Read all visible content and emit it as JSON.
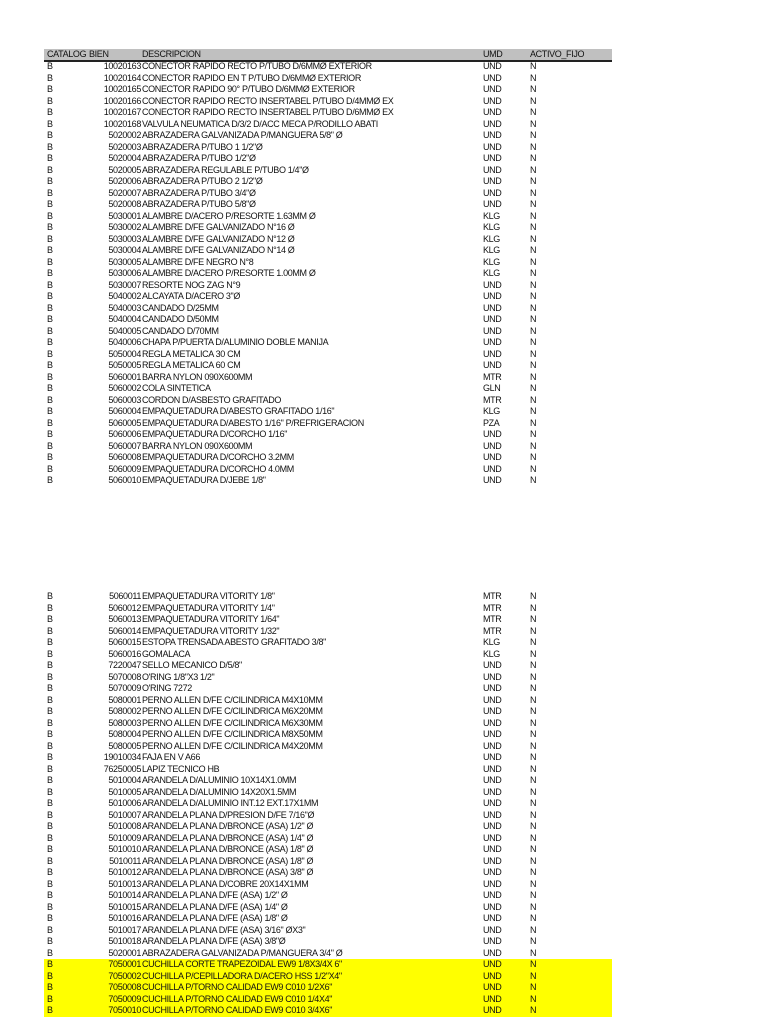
{
  "header": {
    "catalogo": "CATALOG",
    "bien": "BIEN",
    "descripcion": "DESCRIPCION",
    "umd": "UMD",
    "activo_fijo": "ACTIVO_FIJO"
  },
  "colors": {
    "header_bg": "#c0c0c0",
    "highlight": "#ffff00"
  },
  "blocks": [
    [
      [
        "B",
        "10020163",
        "CONECTOR RAPIDO RECTO P/TUBO D/6MMØ EXTERIOR",
        "UND",
        "N"
      ],
      [
        "B",
        "10020164",
        "CONECTOR RAPIDO EN T P/TUBO D/6MMØ EXTERIOR",
        "UND",
        "N"
      ],
      [
        "B",
        "10020165",
        "CONECTOR RAPIDO 90° P/TUBO D/6MMØ EXTERIOR",
        "UND",
        "N"
      ],
      [
        "B",
        "10020166",
        "CONECTOR RAPIDO RECTO INSERTABEL P/TUBO D/4MMØ EX",
        "UND",
        "N"
      ],
      [
        "B",
        "10020167",
        "CONECTOR RAPIDO RECTO INSERTABEL P/TUBO D/6MMØ EX",
        "UND",
        "N"
      ],
      [
        "B",
        "10020168",
        "VALVULA NEUMATICA D/3/2 D/ACC MECA P/RODILLO ABATI",
        "UND",
        "N"
      ],
      [
        "B",
        "5020002",
        "ABRAZADERA GALVANIZADA P/MANGUERA 5/8\" Ø",
        "UND",
        "N"
      ],
      [
        "B",
        "5020003",
        "ABRAZADERA P/TUBO 1 1/2\"Ø",
        "UND",
        "N"
      ],
      [
        "B",
        "5020004",
        "ABRAZADERA P/TUBO 1/2\"Ø",
        "UND",
        "N"
      ],
      [
        "B",
        "5020005",
        "ABRAZADERA REGULABLE P/TUBO 1/4\"Ø",
        "UND",
        "N"
      ],
      [
        "B",
        "5020006",
        "ABRAZADERA P/TUBO 2 1/2\"Ø",
        "UND",
        "N"
      ],
      [
        "B",
        "5020007",
        "ABRAZADERA P/TUBO 3/4\"Ø",
        "UND",
        "N"
      ],
      [
        "B",
        "5020008",
        "ABRAZADERA P/TUBO 5/8\"Ø",
        "UND",
        "N"
      ],
      [
        "B",
        "5030001",
        "ALAMBRE D/ACERO P/RESORTE 1.63MM Ø",
        "KLG",
        "N"
      ],
      [
        "B",
        "5030002",
        "ALAMBRE D/FE GALVANIZADO N°16 Ø",
        "KLG",
        "N"
      ],
      [
        "B",
        "5030003",
        "ALAMBRE D/FE GALVANIZADO N°12 Ø",
        "KLG",
        "N"
      ],
      [
        "B",
        "5030004",
        "ALAMBRE D/FE GALVANIZADO N°14 Ø",
        "KLG",
        "N"
      ],
      [
        "B",
        "5030005",
        "ALAMBRE D/FE NEGRO N°8",
        "KLG",
        "N"
      ],
      [
        "B",
        "5030006",
        "ALAMBRE D/ACERO P/RESORTE 1.00MM Ø",
        "KLG",
        "N"
      ],
      [
        "B",
        "5030007",
        "RESORTE NOG ZAG N°9",
        "UND",
        "N"
      ],
      [
        "B",
        "5040002",
        "ALCAYATA D/ACERO 3\"Ø",
        "UND",
        "N"
      ],
      [
        "B",
        "5040003",
        "CANDADO D/25MM",
        "UND",
        "N"
      ],
      [
        "B",
        "5040004",
        "CANDADO D/50MM",
        "UND",
        "N"
      ],
      [
        "B",
        "5040005",
        "CANDADO D/70MM",
        "UND",
        "N"
      ],
      [
        "B",
        "5040006",
        "CHAPA P/PUERTA D/ALUMINIO DOBLE MANIJA",
        "UND",
        "N"
      ],
      [
        "B",
        "5050004",
        "REGLA METALICA 30 CM",
        "UND",
        "N"
      ],
      [
        "B",
        "5050005",
        "REGLA METALICA 60 CM",
        "UND",
        "N"
      ],
      [
        "B",
        "5060001",
        "BARRA NYLON 090X600MM",
        "MTR",
        "N"
      ],
      [
        "B",
        "5060002",
        "COLA SINTETICA",
        "GLN",
        "N"
      ],
      [
        "B",
        "5060003",
        "CORDON D/ASBESTO GRAFITADO",
        "MTR",
        "N"
      ],
      [
        "B",
        "5060004",
        "EMPAQUETADURA D/ABESTO GRAFITADO 1/16\"",
        "KLG",
        "N"
      ],
      [
        "B",
        "5060005",
        "EMPAQUETADURA D/ABESTO 1/16\" P/REFRIGERACION",
        "PZA",
        "N"
      ],
      [
        "B",
        "5060006",
        "EMPAQUETADURA D/CORCHO 1/16\"",
        "UND",
        "N"
      ],
      [
        "B",
        "5060007",
        "BARRA NYLON 090X600MM",
        "UND",
        "N"
      ],
      [
        "B",
        "5060008",
        "EMPAQUETADURA D/CORCHO 3.2MM",
        "UND",
        "N"
      ],
      [
        "B",
        "5060009",
        "EMPAQUETADURA D/CORCHO 4.0MM",
        "UND",
        "N"
      ],
      [
        "B",
        "5060010",
        "EMPAQUETADURA D/JEBE 1/8\"",
        "UND",
        "N"
      ]
    ],
    [
      [
        "B",
        "5060011",
        "EMPAQUETADURA VITORITY 1/8\"",
        "MTR",
        "N"
      ],
      [
        "B",
        "5060012",
        "EMPAQUETADURA VITORITY 1/4\"",
        "MTR",
        "N"
      ],
      [
        "B",
        "5060013",
        "EMPAQUETADURA VITORITY 1/64\"",
        "MTR",
        "N"
      ],
      [
        "B",
        "5060014",
        "EMPAQUETADURA VITORITY 1/32\"",
        "MTR",
        "N"
      ],
      [
        "B",
        "5060015",
        "ESTOPA TRENSADA ABESTO GRAFITADO 3/8\"",
        "KLG",
        "N"
      ],
      [
        "B",
        "5060016",
        "GOMALACA",
        "KLG",
        "N"
      ],
      [
        "B",
        "7220047",
        "SELLO MECANICO D/5/8\"",
        "UND",
        "N"
      ],
      [
        "B",
        "5070008",
        "O'RING 1/8\"X3 1/2\"",
        "UND",
        "N"
      ],
      [
        "B",
        "5070009",
        "O'RING 7272",
        "UND",
        "N"
      ],
      [
        "B",
        "5080001",
        "PERNO ALLEN D/FE C/CILINDRICA M4X10MM",
        "UND",
        "N"
      ],
      [
        "B",
        "5080002",
        "PERNO ALLEN D/FE C/CILINDRICA M6X20MM",
        "UND",
        "N"
      ],
      [
        "B",
        "5080003",
        "PERNO ALLEN D/FE C/CILINDRICA M6X30MM",
        "UND",
        "N"
      ],
      [
        "B",
        "5080004",
        "PERNO ALLEN D/FE C/CILINDRICA M8X50MM",
        "UND",
        "N"
      ],
      [
        "B",
        "5080005",
        "PERNO ALLEN D/FE C/CILINDRICA M4X20MM",
        "UND",
        "N"
      ],
      [
        "B",
        "19010034",
        "FAJA EN V A66",
        "UND",
        "N"
      ],
      [
        "B",
        "76250005",
        "LAPIZ TECNICO HB",
        "UND",
        "N"
      ],
      [
        "B",
        "5010004",
        "ARANDELA D/ALUMINIO 10X14X1.0MM",
        "UND",
        "N"
      ],
      [
        "B",
        "5010005",
        "ARANDELA D/ALUMINIO 14X20X1.5MM",
        "UND",
        "N"
      ],
      [
        "B",
        "5010006",
        "ARANDELA D/ALUMINIO INT.12 EXT.17X1MM",
        "UND",
        "N"
      ],
      [
        "B",
        "5010007",
        "ARANDELA PLANA D/PRESION D/FE 7/16\"Ø",
        "UND",
        "N"
      ],
      [
        "B",
        "5010008",
        "ARANDELA PLANA D/BRONCE (ASA) 1/2\" Ø",
        "UND",
        "N"
      ],
      [
        "B",
        "5010009",
        "ARANDELA PLANA D/BRONCE (ASA) 1/4\" Ø",
        "UND",
        "N"
      ],
      [
        "B",
        "5010010",
        "ARANDELA PLANA D/BRONCE (ASA) 1/8\" Ø",
        "UND",
        "N"
      ],
      [
        "B",
        "5010011",
        "ARANDELA PLANA D/BRONCE (ASA) 1/8\" Ø",
        "UND",
        "N"
      ],
      [
        "B",
        "5010012",
        "ARANDELA PLANA D/BRONCE (ASA) 3/8\" Ø",
        "UND",
        "N"
      ],
      [
        "B",
        "5010013",
        "ARANDELA PLANA D/COBRE 20X14X1MM",
        "UND",
        "N"
      ],
      [
        "B",
        "5010014",
        "ARANDELA PLANA D/FE (ASA) 1/2\" Ø",
        "UND",
        "N"
      ],
      [
        "B",
        "5010015",
        "ARANDELA PLANA D/FE (ASA) 1/4\" Ø",
        "UND",
        "N"
      ],
      [
        "B",
        "5010016",
        "ARANDELA PLANA D/FE (ASA) 1/8\" Ø",
        "UND",
        "N"
      ],
      [
        "B",
        "5010017",
        "ARANDELA PLANA D/FE (ASA) 3/16\" ØX3\"",
        "UND",
        "N"
      ],
      [
        "B",
        "5010018",
        "ARANDELA PLANA D/FE (ASA) 3/8\"Ø",
        "UND",
        "N"
      ],
      [
        "B",
        "5020001",
        "ABRAZADERA GALVANIZADA P/MANGUERA 3/4\" Ø",
        "UND",
        "N"
      ],
      [
        "B",
        "7050001",
        "CUCHILLA CORTE TRAPEZOIDAL EW9 1/8X3/4X 6\"",
        "UND",
        "N",
        "hl"
      ],
      [
        "B",
        "7050002",
        "CUCHILLA P/CEPILLADORA D/ACERO HSS 1/2\"X4\"",
        "UND",
        "N",
        "hl"
      ],
      [
        "B",
        "7050008",
        "CUCHILLA P/TORNO CALIDAD EW9 C010 1/2X6\"",
        "UND",
        "N",
        "hl"
      ],
      [
        "B",
        "7050009",
        "CUCHILLA P/TORNO CALIDAD EW9 C010 1/4X4\"",
        "UND",
        "N",
        "hl"
      ],
      [
        "B",
        "7050010",
        "CUCHILLA P/TORNO CALIDAD EW9 C010 3/4X6\"",
        "UND",
        "N",
        "hl"
      ]
    ]
  ]
}
